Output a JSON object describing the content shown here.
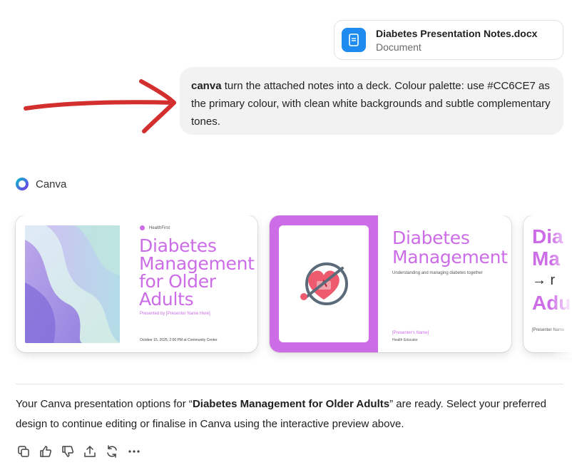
{
  "attachment": {
    "filename": "Diabetes Presentation Notes.docx",
    "type": "Document",
    "icon": "document-icon"
  },
  "user_message": {
    "keyword": "canva",
    "text": " turn the attached notes into a deck. Colour palette: use #CC6CE7 as the primary colour, with clean white backgrounds and subtle complementary tones."
  },
  "tool": {
    "name": "Canva",
    "icon": "canva-logo-icon"
  },
  "slides": [
    {
      "brand": "HealthFirst",
      "title": "Diabetes Management for Older Adults",
      "subtitle": "Presented by [Presenter Name Here]",
      "footer": "October 15, 2025, 2:00 PM at Community Center"
    },
    {
      "title": "Diabetes Management",
      "subtitle": "Understanding and managing diabetes together",
      "presenter": "[Presenter's Name]",
      "role": "Health Educator"
    },
    {
      "title_lines": [
        "Dia",
        "Ma",
        "→ r",
        "Adu"
      ],
      "presenter": "[Presenter Name"
    }
  ],
  "reply": {
    "prefix": "Your Canva presentation options for “",
    "highlight": "Diabetes Management for Older Adults",
    "suffix": "” are ready. Select your preferred design to continue editing or finalise in Canva using the interactive preview above."
  },
  "colors": {
    "primary": "#CC6CE7",
    "annotation_arrow": "#d32f2f",
    "doc_icon_bg": "#1d8bf0"
  }
}
